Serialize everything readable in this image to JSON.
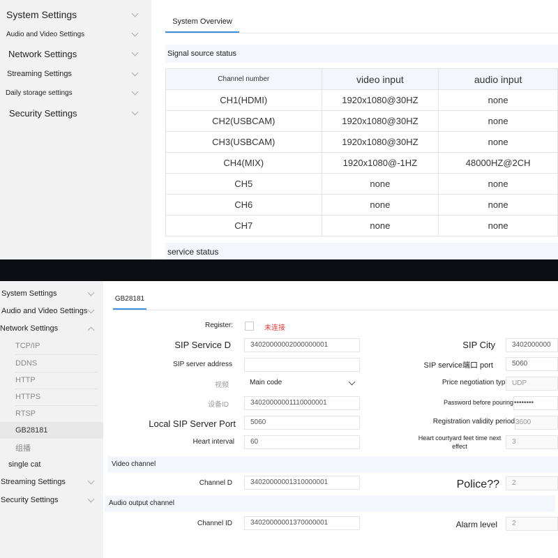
{
  "top": {
    "sidebar": [
      {
        "label": "System Settings"
      },
      {
        "label": "Audio and Video Settings"
      },
      {
        "label": "Network Settings"
      },
      {
        "label": "Streaming Settings"
      },
      {
        "label": "Daily storage settings"
      },
      {
        "label": "Security Settings"
      }
    ],
    "tab": "System Overview",
    "signal_section": "Signal source status",
    "table": {
      "headers": [
        "Channel number",
        "video input",
        "audio input"
      ],
      "rows": [
        [
          "CH1(HDMI)",
          "1920x1080@30HZ",
          "none"
        ],
        [
          "CH2(USBCAM)",
          "1920x1080@30HZ",
          "none"
        ],
        [
          "CH3(USBCAM)",
          "1920x1080@30HZ",
          "none"
        ],
        [
          "CH4(MIX)",
          "1920x1080@-1HZ",
          "48000HZ@2CH"
        ],
        [
          "CH5",
          "none",
          "none"
        ],
        [
          "CH6",
          "none",
          "none"
        ],
        [
          "CH7",
          "none",
          "none"
        ]
      ]
    },
    "service_section": "service status"
  },
  "bottom": {
    "sidebar": {
      "system": "System Settings",
      "audio_video": "Audio and Video Settings",
      "network": "Network Settings",
      "sub_items": [
        "TCP/IP",
        "DDNS",
        "HTTP",
        "HTTPS",
        "RTSP",
        "GB28181",
        "组播"
      ],
      "single_cat": "single cat",
      "streaming": "Streaming Settings",
      "security": "Security Settings"
    },
    "tab": "GB28181",
    "form": {
      "register_label": "Register:",
      "register_status": "未连接",
      "sip_service_d_label": "SIP Service D",
      "sip_service_d_value": "34020000002000000001",
      "sip_server_address_label": "SIP server address",
      "sip_server_address_value": "",
      "video_label": "视频",
      "video_value": "Main code",
      "device_id_label": "设备ID",
      "device_id_value": "34020000001110000001",
      "local_sip_port_label": "Local SIP Server Port",
      "local_sip_port_value": "5060",
      "heart_interval_label": "Heart interval",
      "heart_interval_value": "60",
      "sip_city_label": "SIP City",
      "sip_city_value": "3402000000",
      "sip_service_port_label": "SIP service端口 port",
      "sip_service_port_value": "5060",
      "price_negotiation_label": "Price negotiation type",
      "price_negotiation_value": "UDP",
      "password_label": "Password before pouring",
      "password_value": "••••••••",
      "registration_validity_label": "Registration validity period",
      "registration_validity_value": "3600",
      "heart_courtyard_label_1": "Heart courtyard feet time next",
      "heart_courtyard_label_2": "effect",
      "heart_courtyard_value": "3"
    },
    "video_channel_section": "Video channel",
    "channel_d_label": "Channel D",
    "channel_d_value": "34020000001310000001",
    "police_label": "Police??",
    "police_value": "2",
    "audio_output_section": "Audio output channel",
    "channel_id_label": "Channel ID",
    "channel_id_value": "34020000001370000001",
    "alarm_level_label": "Alarm level",
    "alarm_level_value": "2"
  }
}
